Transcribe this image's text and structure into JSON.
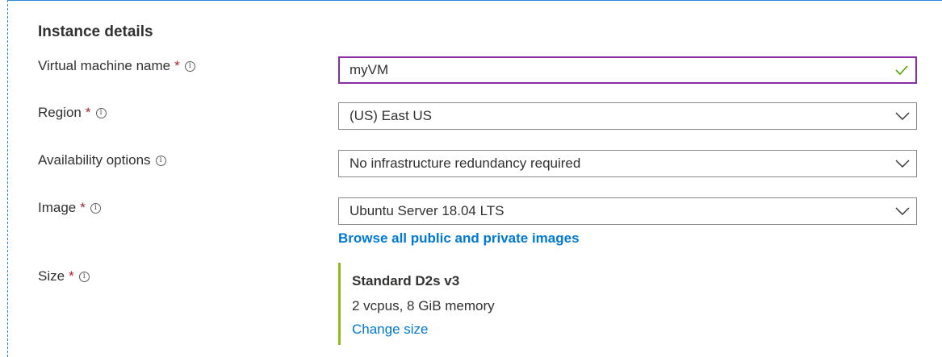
{
  "section": {
    "title": "Instance details"
  },
  "fields": {
    "vm_name": {
      "label": "Virtual machine name",
      "value": "myVM"
    },
    "region": {
      "label": "Region",
      "value": "(US) East US"
    },
    "availability": {
      "label": "Availability options",
      "value": "No infrastructure redundancy required"
    },
    "image": {
      "label": "Image",
      "value": "Ubuntu Server 18.04 LTS",
      "browse_link": "Browse all public and private images"
    },
    "size": {
      "label": "Size",
      "name": "Standard D2s v3",
      "spec": "2 vcpus, 8 GiB memory",
      "change_link": "Change size"
    }
  },
  "required_marker": "*",
  "info_glyph": "i",
  "colors": {
    "required": "#a4262c",
    "focus_border": "#8a2da5",
    "valid_check": "#57a300",
    "link": "#0078d4",
    "size_accent": "#8cbd18"
  },
  "icons": {
    "valid": "checkmark-icon",
    "dropdown": "chevron-down-icon",
    "info": "info-icon"
  }
}
